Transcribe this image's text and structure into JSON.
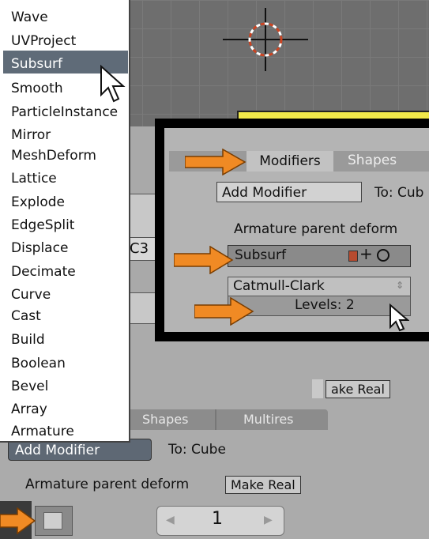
{
  "viewport": {
    "cursor_icon": "3d-cursor-icon"
  },
  "modifier_menu": {
    "items": [
      "Wave",
      "UVProject",
      "Subsurf",
      "Smooth",
      "ParticleInstance",
      "Mirror",
      "MeshDeform",
      "Lattice",
      "Explode",
      "EdgeSplit",
      "Displace",
      "Decimate",
      "Curve",
      "Cast",
      "Build",
      "Boolean",
      "Bevel",
      "Array",
      "Armature"
    ],
    "highlighted": "Subsurf"
  },
  "background_panel": {
    "tabs": {
      "shapes": "Shapes",
      "multires": "Multires"
    },
    "add_modifier": "Add Modifier",
    "to_target": "To: Cube",
    "armature_parent_deform": "Armature parent deform",
    "make_real": "Make Real",
    "make_real_mid": "ake Real",
    "hidden_field_text": "C3",
    "frame": {
      "value": "1",
      "left_arrow": "◀",
      "right_arrow": "▶"
    }
  },
  "inset": {
    "tabs": {
      "modifiers": "Modifiers",
      "shapes": "Shapes"
    },
    "add_modifier": "Add Modifier",
    "to_target": "To: Cub",
    "armature_parent_deform": "Armature parent deform",
    "modifier_name": "Subsurf",
    "subdivision_type": "Catmull-Clark",
    "levels": "Levels: 2"
  },
  "colors": {
    "arrow": "#f08a24",
    "highlight": "#5f6b78",
    "yellow": "#f0e84a"
  }
}
